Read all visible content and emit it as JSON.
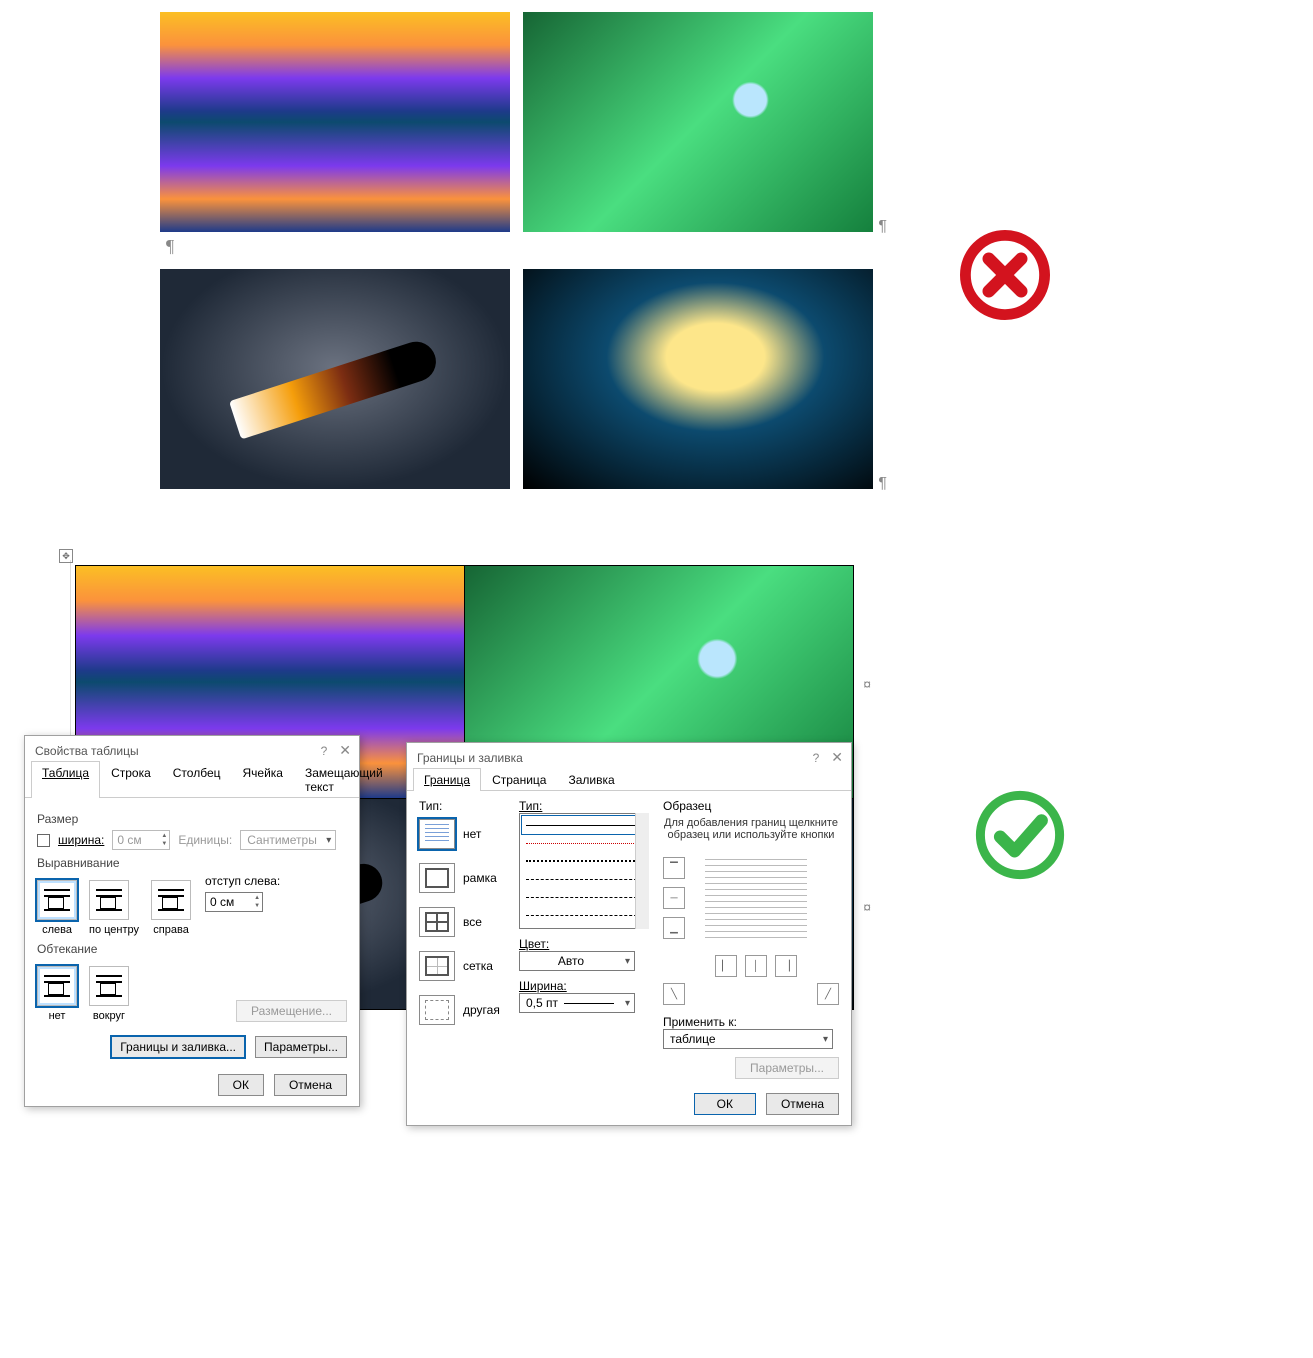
{
  "para_mark": "¶",
  "cell_mark": "¤",
  "dlg1": {
    "title": "Свойства таблицы",
    "help": "?",
    "tabs": {
      "t1": "Таблица",
      "t2": "Строка",
      "t3": "Столбец",
      "t4": "Ячейка",
      "t5": "Замещающий текст"
    },
    "size_label": "Размер",
    "width_cb": "ширина:",
    "width_val": "0 см",
    "units_lbl": "Единицы:",
    "units_val": "Сантиметры",
    "align_label": "Выравнивание",
    "indent_lbl": "отступ слева:",
    "indent_val": "0 см",
    "align": {
      "left": "слева",
      "center": "по центру",
      "right": "справа"
    },
    "wrap_label": "Обтекание",
    "wrap": {
      "none": "нет",
      "around": "вокруг"
    },
    "pos_btn": "Размещение...",
    "borders_btn": "Границы и заливка...",
    "params_btn": "Параметры...",
    "ok": "ОК",
    "cancel": "Отмена"
  },
  "dlg2": {
    "title": "Границы и заливка",
    "help": "?",
    "tabs": {
      "t1": "Граница",
      "t2": "Страница",
      "t3": "Заливка"
    },
    "type_lbl": "Тип:",
    "types": {
      "none": "нет",
      "frame": "рамка",
      "all": "все",
      "grid": "сетка",
      "other": "другая"
    },
    "style_lbl": "Тип:",
    "color_lbl": "Цвет:",
    "color_val": "Авто",
    "width_lbl": "Ширина:",
    "width_val": "0,5 пт",
    "preview_lbl": "Образец",
    "preview_hint": "Для добавления границ щелкните образец или используйте кнопки",
    "apply_lbl": "Применить к:",
    "apply_val": "таблице",
    "params_btn": "Параметры...",
    "ok": "ОК",
    "cancel": "Отмена"
  }
}
